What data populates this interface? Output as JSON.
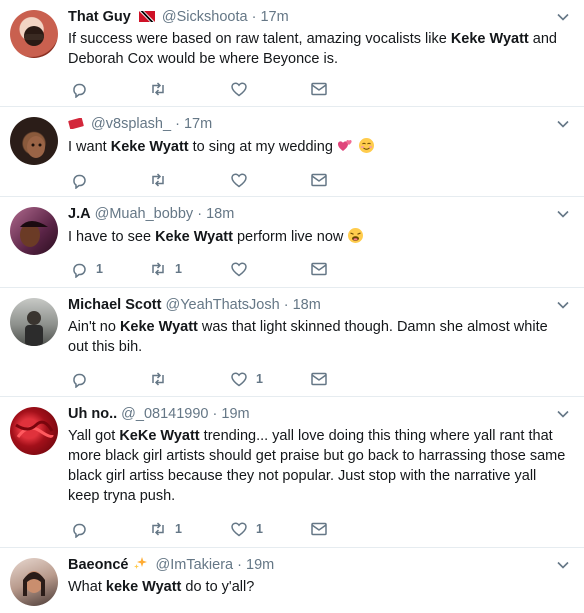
{
  "tweets": [
    {
      "name": "That Guy",
      "handle": "@Sickshoota",
      "sep": "·",
      "time": "17m",
      "text_parts": [
        "If success were based on raw talent, amazing vocalists like ",
        "Keke Wyatt",
        " and Deborah Cox would be where Beyonce is."
      ],
      "reply_count": "",
      "retweet_count": "",
      "like_count": "",
      "avatar_color": "#c9604f"
    },
    {
      "name": "",
      "handle": "@v8splash_",
      "sep": "·",
      "time": "17m",
      "text_parts": [
        "I want ",
        "Keke Wyatt",
        " to sing at my wedding"
      ],
      "reply_count": "",
      "retweet_count": "",
      "like_count": "",
      "avatar_color": "#3b2a24"
    },
    {
      "name": "J.A",
      "handle": "@Muah_bobby",
      "sep": "·",
      "time": "18m",
      "text_parts": [
        "I have to see ",
        "Keke Wyatt",
        " perform live now"
      ],
      "reply_count": "1",
      "retweet_count": "1",
      "like_count": "",
      "avatar_color": "#8a3f6e"
    },
    {
      "name": "Michael Scott",
      "handle": "@YeahThatsJosh",
      "sep": "·",
      "time": "18m",
      "text_parts": [
        "Ain't no ",
        "Keke Wyatt",
        " was that light skinned though. Damn she almost white out this bih."
      ],
      "reply_count": "",
      "retweet_count": "",
      "like_count": "1",
      "avatar_color": "#7d7f7c"
    },
    {
      "name": "Uh no..",
      "handle": "@_08141990",
      "sep": "·",
      "time": "19m",
      "text_parts": [
        "Yall got ",
        "KeKe Wyatt",
        " trending... yall love doing this thing where yall rant that more black girl artists should get praise but go back to harrassing those same black girl artiss because they not popular. Just stop with the narrative yall keep tryna push."
      ],
      "reply_count": "",
      "retweet_count": "1",
      "like_count": "1",
      "avatar_color": "#b31620"
    },
    {
      "name": "Baeoncé",
      "handle": "@ImTakiera",
      "sep": "·",
      "time": "19m",
      "text_parts": [
        "What ",
        "keke Wyatt",
        " do to y'all?"
      ],
      "reply_count": "",
      "retweet_count": "",
      "like_count": "",
      "avatar_color": "#b89a8c"
    }
  ],
  "icons": {
    "reply": "reply-icon",
    "retweet": "retweet-icon",
    "like": "heart-icon",
    "dm": "envelope-icon",
    "more": "chevron-down-icon"
  },
  "colors": {
    "text": "#14171a",
    "muted": "#657786",
    "divider": "#e6ecf0"
  }
}
